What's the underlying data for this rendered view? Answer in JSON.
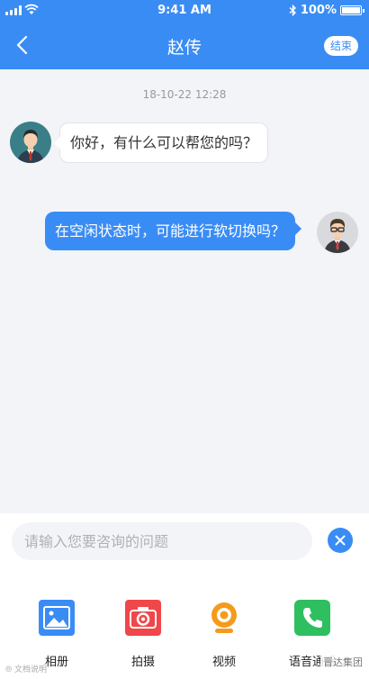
{
  "status_bar": {
    "time": "9:41 AM",
    "battery": "100%"
  },
  "nav": {
    "title": "赵传",
    "end_label": "结束"
  },
  "chat": {
    "timestamp": "18-10-22 12:28",
    "messages": [
      {
        "from": "agent",
        "text": "你好，有什么可以帮您的吗？"
      },
      {
        "from": "user",
        "text": "在空闲状态时，可能进行软切换吗？"
      }
    ]
  },
  "input": {
    "placeholder": "请输入您要咨询的问题",
    "value": ""
  },
  "toolbar": {
    "items": [
      {
        "label": "相册",
        "icon": "album-icon",
        "color": "#3a8cf5"
      },
      {
        "label": "拍摄",
        "icon": "camera-icon",
        "color": "#f0474a"
      },
      {
        "label": "视频",
        "icon": "video-icon",
        "color": "#f59b1c"
      },
      {
        "label": "语音通话",
        "icon": "phone-icon",
        "color": "#2fbf60"
      }
    ]
  },
  "watermark": {
    "left": "⦾ 文档说明",
    "right": "晋达集团"
  },
  "colors": {
    "primary": "#3a8cf5",
    "background": "#f3f4f8"
  }
}
